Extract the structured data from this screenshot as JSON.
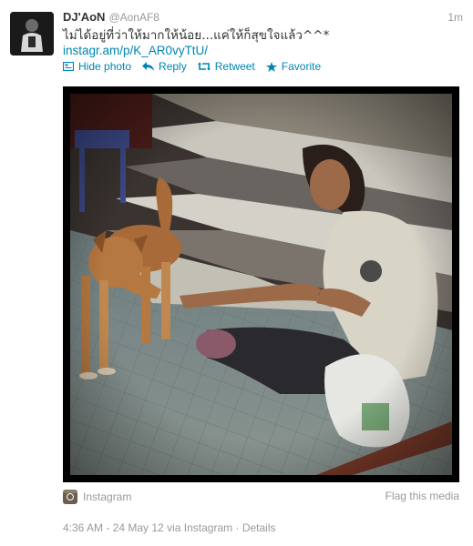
{
  "tweet": {
    "fullname": "DJ'AoN",
    "username": "@AonAF8",
    "time": "1m",
    "text": "ไม่ได้อยู่ที่ว่าให้มากให้น้อย...แค่ให้ก็สุขใจแล้ว^^*",
    "link": "instagr.am/p/K_AR0vyTtU/"
  },
  "actions": {
    "hide_photo": "Hide photo",
    "reply": "Reply",
    "retweet": "Retweet",
    "favorite": "Favorite"
  },
  "media": {
    "source": "Instagram",
    "flag": "Flag this media"
  },
  "meta": {
    "timestamp": "4:36 AM - 24 May 12",
    "via_prefix": "via",
    "via_app": "Instagram",
    "separator": "·",
    "details": "Details"
  },
  "colors": {
    "link": "#0084b4",
    "muted": "#999999",
    "text": "#333333"
  }
}
